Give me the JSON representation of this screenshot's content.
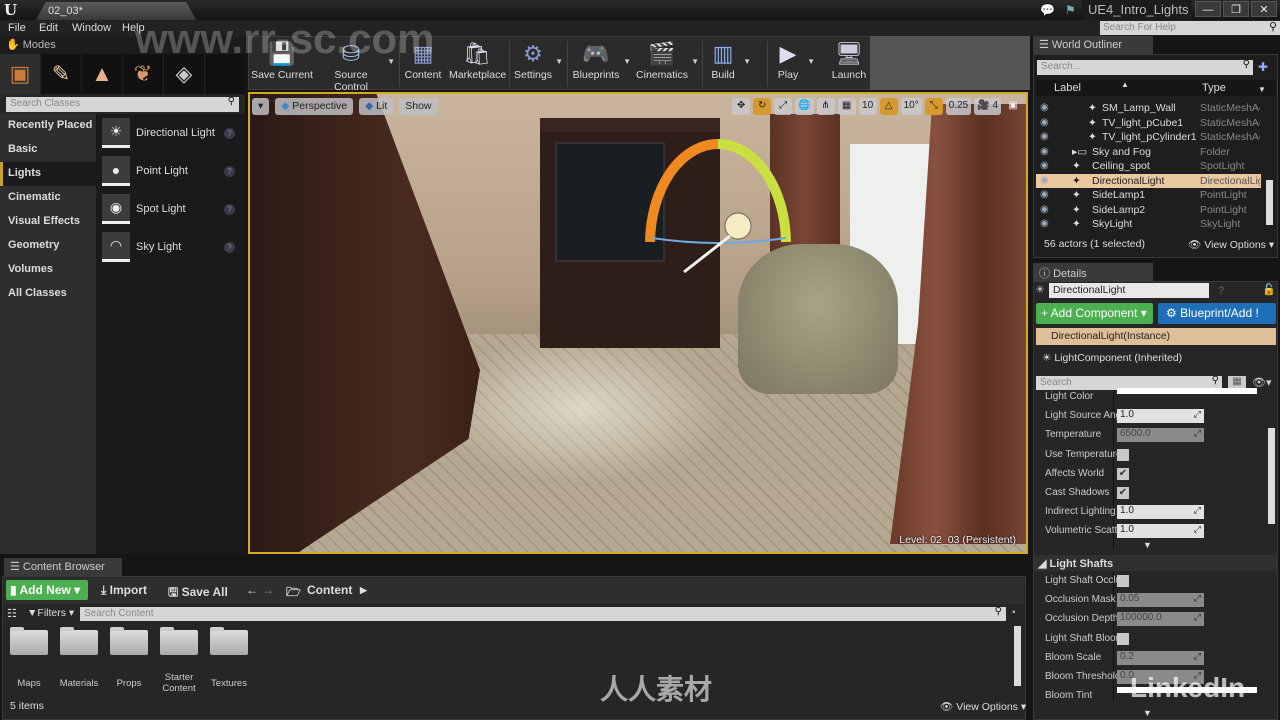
{
  "titlebar": {
    "document_tab": "02_03*",
    "project_name": "UE4_Intro_Lights",
    "minimize": "—",
    "maximize": "❐",
    "close": "✕"
  },
  "menu": {
    "items": [
      "File",
      "Edit",
      "Window",
      "Help"
    ],
    "help_search_placeholder": "Search For Help"
  },
  "modes": {
    "tab_label": "Modes",
    "mode_icons": [
      "place-mode-icon",
      "paint-mode-icon",
      "landscape-mode-icon",
      "foliage-mode-icon",
      "geometry-edit-mode-icon"
    ],
    "search_placeholder": "Search Classes",
    "categories": [
      "Recently Placed",
      "Basic",
      "Lights",
      "Cinematic",
      "Visual Effects",
      "Geometry",
      "Volumes",
      "All Classes"
    ],
    "active_category": "Lights",
    "placeables": [
      {
        "label": "Directional Light",
        "icon": "directional-light-icon"
      },
      {
        "label": "Point Light",
        "icon": "point-light-icon"
      },
      {
        "label": "Spot Light",
        "icon": "spot-light-icon"
      },
      {
        "label": "Sky Light",
        "icon": "sky-light-icon"
      }
    ]
  },
  "toolbar": {
    "buttons": [
      {
        "label": "Save Current",
        "icon": "save-icon",
        "dropdown": false
      },
      {
        "label": "Source Control",
        "icon": "source-control-icon",
        "dropdown": true
      },
      {
        "label": "Content",
        "icon": "content-icon",
        "dropdown": false
      },
      {
        "label": "Marketplace",
        "icon": "marketplace-icon",
        "dropdown": false
      },
      {
        "label": "Settings",
        "icon": "settings-icon",
        "dropdown": true
      },
      {
        "label": "Blueprints",
        "icon": "blueprints-icon",
        "dropdown": true
      },
      {
        "label": "Cinematics",
        "icon": "cinematics-icon",
        "dropdown": true
      },
      {
        "label": "Build",
        "icon": "build-icon",
        "dropdown": true
      },
      {
        "label": "Play",
        "icon": "play-icon",
        "dropdown": true
      },
      {
        "label": "Launch",
        "icon": "launch-icon",
        "dropdown": false
      }
    ]
  },
  "viewport": {
    "view_mode_dropdown": "▾",
    "perspective": "Perspective",
    "lit": "Lit",
    "show": "Show",
    "grid_snap_value": "10",
    "rotation_snap_value": "10°",
    "scale_snap_value": "0.25",
    "camera_speed": "4",
    "level_label": "Level:  02_03 (Persistent)"
  },
  "world_outliner": {
    "tab_label": "World Outliner",
    "search_placeholder": "Search...",
    "col_label": "Label",
    "col_type": "Type",
    "rows": [
      {
        "label": "SM_Lamp_Wall",
        "type": "StaticMeshAc",
        "indent": 2,
        "selected": false
      },
      {
        "label": "TV_light_pCube1",
        "type": "StaticMeshAc",
        "indent": 2,
        "selected": false
      },
      {
        "label": "TV_light_pCylinder1",
        "type": "StaticMeshAc",
        "indent": 2,
        "selected": false
      },
      {
        "label": "Sky and Fog",
        "type": "Folder",
        "indent": 1,
        "selected": false
      },
      {
        "label": "Ceiling_spot",
        "type": "SpotLight",
        "indent": 1,
        "selected": false
      },
      {
        "label": "DirectionalLight",
        "type": "DirectionalLig",
        "indent": 1,
        "selected": true
      },
      {
        "label": "SideLamp1",
        "type": "PointLight",
        "indent": 1,
        "selected": false
      },
      {
        "label": "SideLamp2",
        "type": "PointLight",
        "indent": 1,
        "selected": false
      },
      {
        "label": "SkyLight",
        "type": "SkyLight",
        "indent": 1,
        "selected": false
      }
    ],
    "actor_count": "56 actors (1 selected)",
    "view_options": "View Options"
  },
  "details": {
    "tab_label": "Details",
    "actor_name": "DirectionalLight",
    "add_component": "+ Add Component",
    "blueprint_add": "Blueprint/Add !",
    "component_instance": "DirectionalLight(Instance)",
    "component_light": "LightComponent (Inherited)",
    "search_placeholder": "Search",
    "properties": [
      {
        "label": "Light Color",
        "kind": "swatch",
        "value": "#ffffff"
      },
      {
        "label": "Light Source Angle",
        "kind": "number",
        "value": "1.0"
      },
      {
        "label": "Temperature",
        "kind": "number-disabled",
        "value": "6500.0"
      },
      {
        "label": "Use Temperature",
        "kind": "checkbox",
        "checked": false
      },
      {
        "label": "Affects World",
        "kind": "checkbox",
        "checked": true
      },
      {
        "label": "Cast Shadows",
        "kind": "checkbox",
        "checked": true
      },
      {
        "label": "Indirect Lighting Intensity",
        "kind": "number",
        "value": "1.0"
      },
      {
        "label": "Volumetric Scattering Intensity",
        "kind": "number",
        "value": "1.0"
      }
    ],
    "light_shafts_section": "Light Shafts",
    "light_shaft_properties": [
      {
        "label": "Light Shaft Occlusion",
        "kind": "checkbox",
        "checked": false
      },
      {
        "label": "Occlusion Mask Darkness",
        "kind": "number-disabled",
        "value": "0.05"
      },
      {
        "label": "Occlusion Depth Range",
        "kind": "number-disabled",
        "value": "100000.0"
      },
      {
        "label": "Light Shaft Bloom",
        "kind": "checkbox",
        "checked": false
      },
      {
        "label": "Bloom Scale",
        "kind": "number-disabled",
        "value": "0.2"
      },
      {
        "label": "Bloom Threshold",
        "kind": "number-disabled",
        "value": "0.0"
      },
      {
        "label": "Bloom Tint",
        "kind": "swatch",
        "value": "#ffffff"
      }
    ]
  },
  "content_browser": {
    "tab_label": "Content Browser",
    "add_new": "Add New",
    "import": "Import",
    "save_all": "Save All",
    "path": "Content",
    "filters": "Filters",
    "search_placeholder": "Search Content",
    "folders": [
      "Maps",
      "Materials",
      "Props",
      "Starter Content",
      "Textures"
    ],
    "item_count": "5 items",
    "view_options": "View Options"
  },
  "watermarks": {
    "site": "www.rr-sc.com",
    "cn": "人人素材",
    "brand": "LinkedIn"
  }
}
